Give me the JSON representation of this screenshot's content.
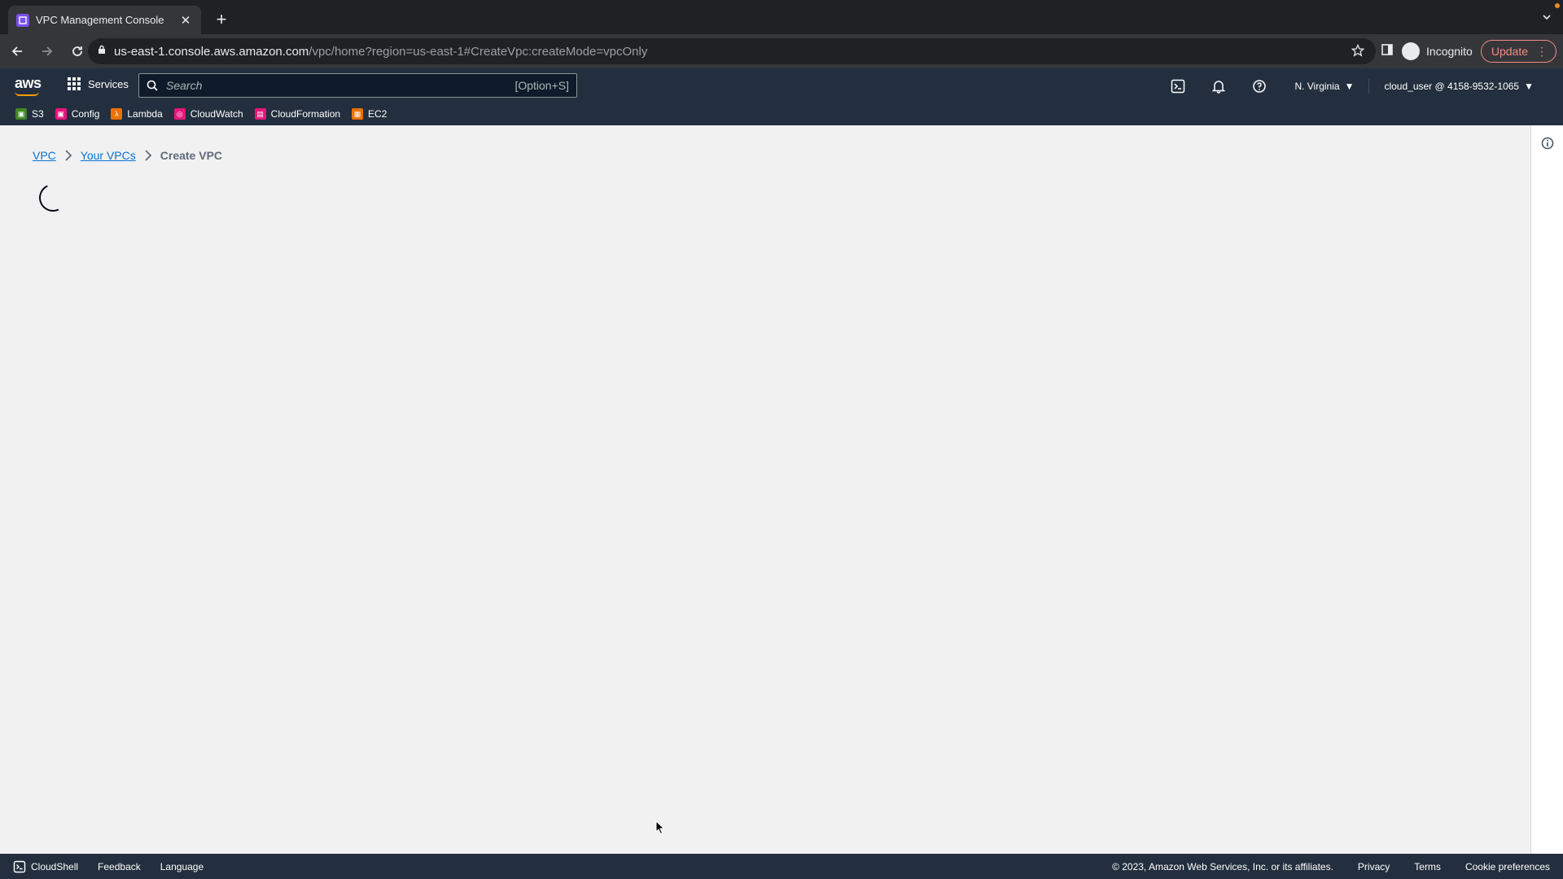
{
  "browser": {
    "tab_title": "VPC Management Console",
    "url_host": "us-east-1.console.aws.amazon.com",
    "url_path": "/vpc/home?region=us-east-1#CreateVpc:createMode=vpcOnly",
    "incognito_label": "Incognito",
    "update_label": "Update"
  },
  "aws_nav": {
    "logo": "aws",
    "services_label": "Services",
    "search_placeholder": "Search",
    "search_shortcut": "[Option+S]",
    "region": "N. Virginia",
    "account": "cloud_user @ 4158-9532-1065",
    "favorites": [
      {
        "label": "S3",
        "color": "#3f8624"
      },
      {
        "label": "Config",
        "color": "#e7157b"
      },
      {
        "label": "Lambda",
        "color": "#ed7100"
      },
      {
        "label": "CloudWatch",
        "color": "#e7157b"
      },
      {
        "label": "CloudFormation",
        "color": "#e7157b"
      },
      {
        "label": "EC2",
        "color": "#ed7100"
      }
    ]
  },
  "breadcrumb": {
    "items": [
      "VPC",
      "Your VPCs",
      "Create VPC"
    ]
  },
  "footer": {
    "cloudshell": "CloudShell",
    "feedback": "Feedback",
    "language": "Language",
    "copyright": "© 2023, Amazon Web Services, Inc. or its affiliates.",
    "privacy": "Privacy",
    "terms": "Terms",
    "cookie": "Cookie preferences"
  }
}
